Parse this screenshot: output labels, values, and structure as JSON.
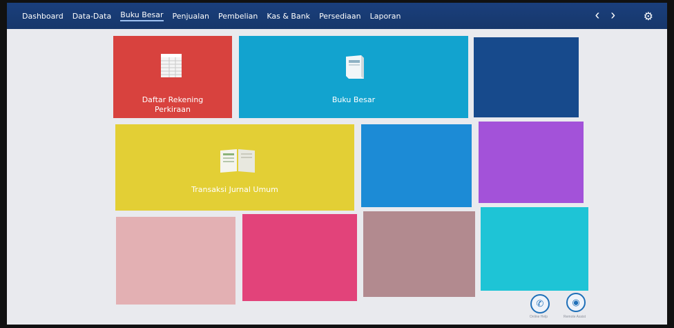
{
  "navbar": {
    "items": [
      {
        "label": "Dashboard"
      },
      {
        "label": "Data-Data"
      },
      {
        "label": "Buku Besar"
      },
      {
        "label": "Penjualan"
      },
      {
        "label": "Pembelian"
      },
      {
        "label": "Kas & Bank"
      },
      {
        "label": "Persediaan"
      },
      {
        "label": "Laporan"
      }
    ],
    "active_index": 2,
    "back_icon": "chevron-left-icon",
    "forward_icon": "chevron-right-icon",
    "settings_icon": "gear-icon"
  },
  "tiles": {
    "daftar_rekening": {
      "label": "Daftar Rekening Perkiraan",
      "color": "#d8423e",
      "icon": "ledger-icon"
    },
    "buku_besar": {
      "label": "Buku Besar",
      "color": "#12a3cf",
      "icon": "book-icon"
    },
    "dark_blue": {
      "label": "",
      "color": "#174a8c"
    },
    "transaksi_jurnal": {
      "label": "Transaksi Jurnal Umum",
      "color": "#e3cf35",
      "icon": "open-book-icon"
    },
    "blue": {
      "label": "",
      "color": "#1c8bd6"
    },
    "purple": {
      "label": "",
      "color": "#a352d9"
    },
    "pink_light": {
      "label": "",
      "color": "#e3b0b3"
    },
    "magenta": {
      "label": "",
      "color": "#e2437a"
    },
    "mauve": {
      "label": "",
      "color": "#b28a8f"
    },
    "cyan": {
      "label": "",
      "color": "#1ec4d6"
    }
  },
  "footer": {
    "online_help": {
      "label": "Online Help",
      "icon": "phone-icon"
    },
    "remote_assist": {
      "label": "Remote Assist",
      "icon": "globe-icon"
    }
  }
}
